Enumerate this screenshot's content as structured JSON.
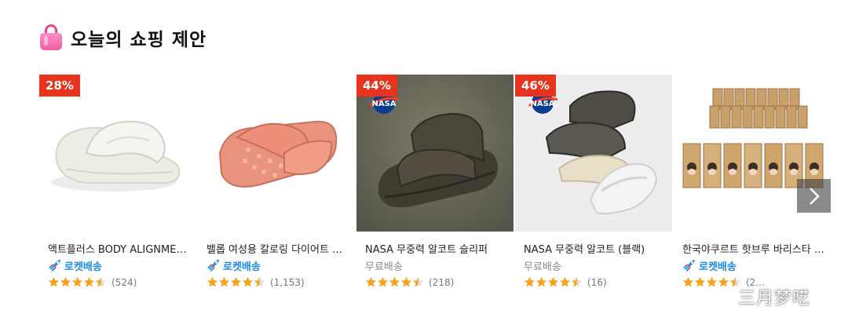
{
  "section": {
    "title": "오늘의 쇼핑 제안",
    "icon": "shopping-bag-icon"
  },
  "products": [
    {
      "name": "액트플러스 BODY ALIGNMENT 남녀공용 슬리퍼",
      "discount": "28%",
      "delivery": "로켓배송",
      "delivery_type": "rocket",
      "rating": 4.5,
      "reviews": "(524)",
      "image": "cream-slide-sandal"
    },
    {
      "name": "밸롭 여성용 칼로링 다이어트 슬리퍼",
      "discount": "",
      "delivery": "로켓배송",
      "delivery_type": "rocket",
      "rating": 4.5,
      "reviews": "(1,153)",
      "image": "pink-massage-slipper"
    },
    {
      "name": "NASA 무중력 알코트 슬리퍼",
      "discount": "44%",
      "delivery": "무료배송",
      "delivery_type": "free",
      "rating": 4.5,
      "reviews": "(218)",
      "image": "olive-two-strap-sandal",
      "brand_logo": "NASA"
    },
    {
      "name": "NASA 무중력 알코트 (블랙)",
      "discount": "46%",
      "delivery": "무료배송",
      "delivery_type": "free",
      "rating": 4.5,
      "reviews": "(16)",
      "image": "stacked-sandals",
      "brand_logo": "NASA"
    },
    {
      "name": "한국야쿠르트 핫브루 바리스타 커피",
      "discount": "",
      "delivery": "로켓배송",
      "delivery_type": "rocket",
      "rating": 4.5,
      "reviews": "(2...",
      "image": "coffee-cans"
    }
  ],
  "carousel": {
    "next_icon": "chevron-right-icon"
  },
  "watermark": {
    "text": "三月梦呓",
    "icon": "wechat-icon"
  },
  "colors": {
    "discount_badge": "#e8341c",
    "rocket_blue": "#1a8be6",
    "star": "#f7a21b"
  }
}
